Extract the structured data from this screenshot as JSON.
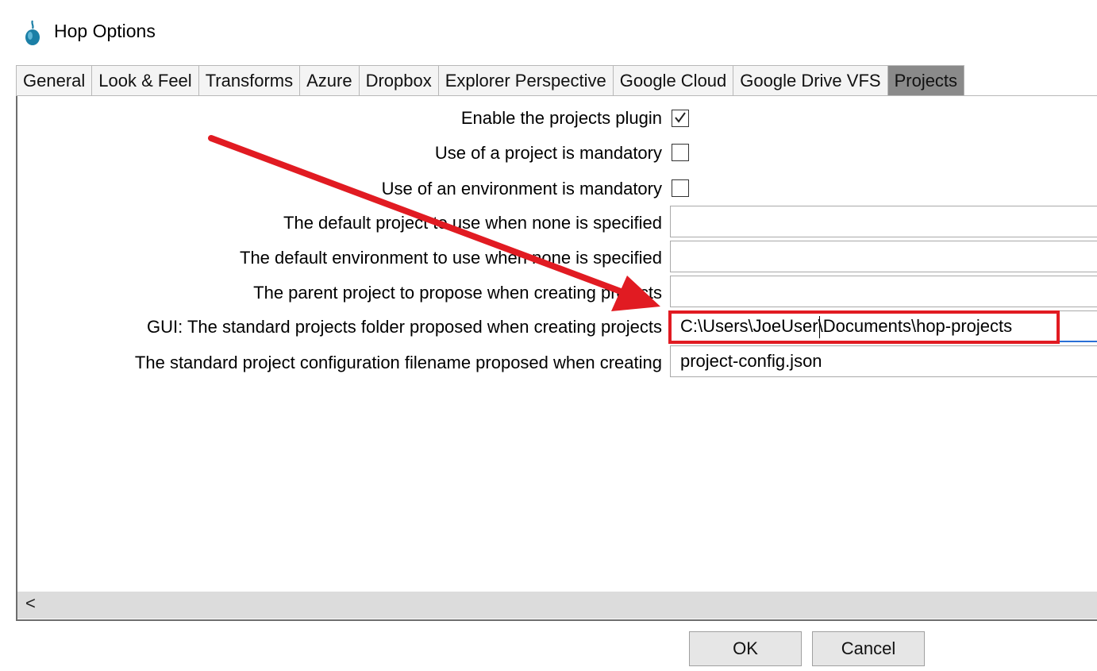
{
  "window": {
    "title": "Hop Options"
  },
  "tabs": [
    {
      "label": "General"
    },
    {
      "label": "Look & Feel"
    },
    {
      "label": "Transforms"
    },
    {
      "label": "Azure"
    },
    {
      "label": "Dropbox"
    },
    {
      "label": "Explorer Perspective"
    },
    {
      "label": "Google Cloud"
    },
    {
      "label": "Google Drive VFS"
    },
    {
      "label": "Projects",
      "active": true
    }
  ],
  "options": {
    "enable_plugin": {
      "label": "Enable the projects plugin",
      "checked": true
    },
    "project_mandatory": {
      "label": "Use of a project is mandatory",
      "checked": false
    },
    "environment_mandatory": {
      "label": "Use of an environment is mandatory",
      "checked": false
    },
    "default_project": {
      "label": "The default project to use when none is specified",
      "value": ""
    },
    "default_environment": {
      "label": "The default environment to use when none is specified",
      "value": ""
    },
    "parent_project": {
      "label": "The parent project to propose when creating projects",
      "value": ""
    },
    "projects_folder": {
      "label": "GUI: The standard projects folder proposed when creating projects",
      "value": "C:\\Users\\JoeUser\\Documents\\hop-projects"
    },
    "config_filename": {
      "label": "The standard project configuration filename proposed when creating",
      "value": "project-config.json"
    }
  },
  "scrollbar": {
    "left_arrow": "<"
  },
  "buttons": {
    "ok": "OK",
    "cancel": "Cancel"
  },
  "colors": {
    "annotation": "#e11b22",
    "active_tab": "#8a8a8a",
    "focus": "#2a6fd6"
  },
  "icons": {
    "app": "hop-logo-icon",
    "check": "checkmark-icon",
    "arrow": "annotation-arrow-icon"
  }
}
